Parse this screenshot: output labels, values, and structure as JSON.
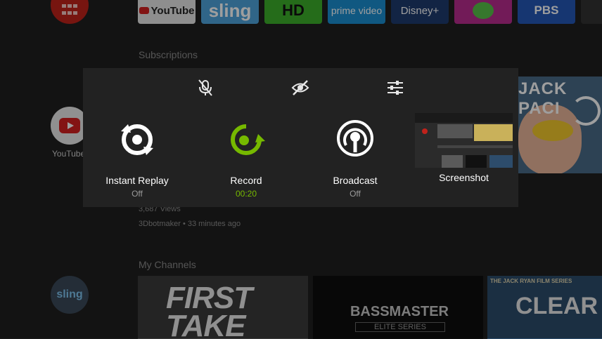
{
  "top_row": {
    "youtube": "YouTube",
    "sling": "sling",
    "hd": "HD",
    "prime": "prime video",
    "disney": "Disney+",
    "pbs": "PBS"
  },
  "sections": {
    "subscriptions": "Subscriptions",
    "my_channels": "My Channels"
  },
  "left_apps": {
    "youtube_label": "YouTube",
    "sling_label": "sling"
  },
  "video_meta": {
    "views": "3,687 Views",
    "channel_time": "3Dbotmaker • 33 minutes ago"
  },
  "thumb_caption": "JACK PACI",
  "channels": {
    "first_take": "FIRST TAKE",
    "bassmaster": "BASSMASTER",
    "elite_series": "ELITE SERIES",
    "jack_series": "THE JACK RYAN FILM SERIES",
    "clear": "CLEAR"
  },
  "overlay": {
    "top_icons": [
      "microphone-off-icon",
      "camera-off-icon",
      "settings-sliders-icon"
    ],
    "features": [
      {
        "label": "Instant Replay",
        "status": "Off"
      },
      {
        "label": "Record",
        "status": "00:20"
      },
      {
        "label": "Broadcast",
        "status": "Off"
      },
      {
        "label": "Screenshot",
        "status": ""
      }
    ],
    "accent_color": "#76b900"
  }
}
